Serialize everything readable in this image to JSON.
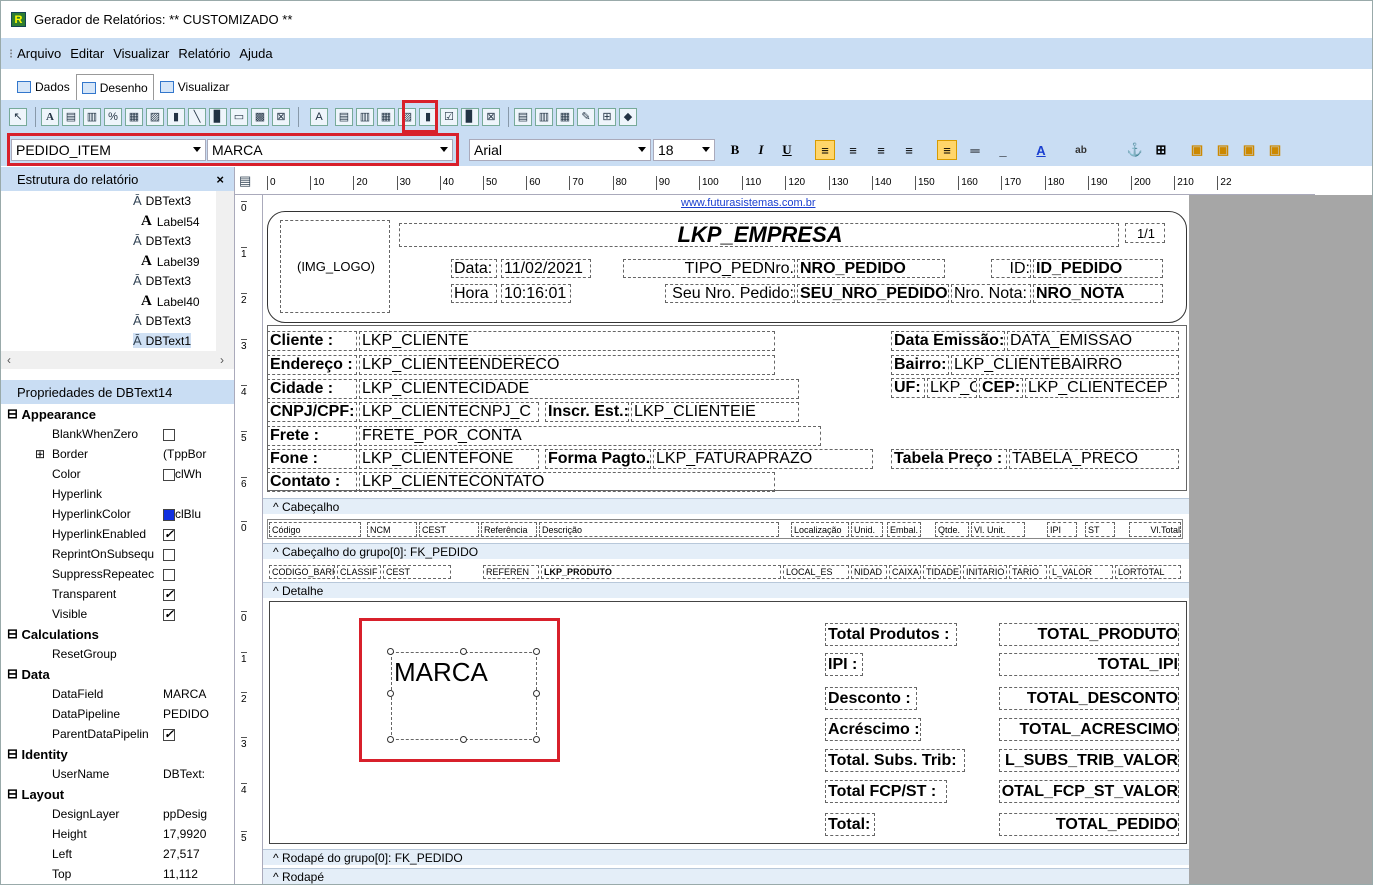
{
  "window": {
    "title": "Gerador de Relatórios: ** CUSTOMIZADO **"
  },
  "menu": [
    "Arquivo",
    "Editar",
    "Visualizar",
    "Relatório",
    "Ajuda"
  ],
  "tabs": [
    "Dados",
    "Desenho",
    "Visualizar"
  ],
  "selectors": {
    "pipeline": "PEDIDO_ITEM",
    "field": "MARCA",
    "font": "Arial",
    "size": "18"
  },
  "tree_panel": {
    "title": "Estrutura do relatório",
    "items": [
      "DBText3",
      "Label54",
      "DBText3",
      "Label39",
      "DBText3",
      "Label40",
      "DBText3",
      "DBText1"
    ]
  },
  "props_panel": {
    "title": "Propriedades de DBText14",
    "categories": [
      {
        "name": "Appearance",
        "rows": [
          {
            "name": "BlankWhenZero",
            "value": ""
          },
          {
            "name": "Border",
            "value": "(TppBor"
          },
          {
            "name": "Color",
            "value": "clWh"
          },
          {
            "name": "Hyperlink",
            "value": ""
          },
          {
            "name": "HyperlinkColor",
            "value": "clBlu"
          },
          {
            "name": "HyperlinkEnabled",
            "value": ""
          },
          {
            "name": "ReprintOnSubsequ",
            "value": ""
          },
          {
            "name": "SuppressRepeatec",
            "value": ""
          },
          {
            "name": "Transparent",
            "value": ""
          },
          {
            "name": "Visible",
            "value": ""
          }
        ]
      },
      {
        "name": "Calculations",
        "rows": [
          {
            "name": "ResetGroup",
            "value": ""
          }
        ]
      },
      {
        "name": "Data",
        "rows": [
          {
            "name": "DataField",
            "value": "MARCA"
          },
          {
            "name": "DataPipeline",
            "value": "PEDIDO"
          },
          {
            "name": "ParentDataPipelin",
            "value": ""
          }
        ]
      },
      {
        "name": "Identity",
        "rows": [
          {
            "name": "UserName",
            "value": "DBText:"
          }
        ]
      },
      {
        "name": "Layout",
        "rows": [
          {
            "name": "DesignLayer",
            "value": "ppDesig"
          },
          {
            "name": "Height",
            "value": "17,9920"
          },
          {
            "name": "Left",
            "value": "27,517"
          },
          {
            "name": "Top",
            "value": "11,112"
          }
        ]
      }
    ]
  },
  "ruler_labels": [
    "0",
    "10",
    "20",
    "30",
    "40",
    "50",
    "60",
    "70",
    "80",
    "90",
    "100",
    "110",
    "120",
    "130",
    "140",
    "150",
    "160",
    "170",
    "180",
    "190",
    "200",
    "210",
    "22"
  ],
  "vruler_labels": [
    "0",
    "1",
    "2",
    "3",
    "4",
    "5",
    "6",
    "0",
    "0",
    "1",
    "2",
    "3",
    "4",
    "5"
  ],
  "report": {
    "website": "www.futurasistemas.com.br",
    "company": "LKP_EMPRESA",
    "pages": "1/1",
    "logo": "(IMG_LOGO)",
    "data_label": "Data:",
    "data_value": "11/02/2021",
    "hora_label": "Hora",
    "hora_value": "10:16:01",
    "tipo": "TIPO_PEDNro.",
    "nro_pedido": "NRO_PEDIDO",
    "id_label": "ID:",
    "id_pedido": "ID_PEDIDO",
    "seu_label": "Seu Nro. Pedido:",
    "seu_nro": "SEU_NRO_PEDIDO",
    "nota_label": "Nro. Nota:",
    "nro_nota": "NRO_NOTA",
    "cliente_label": "Cliente :",
    "cliente": "LKP_CLIENTE",
    "endereco_label": "Endereço :",
    "endereco": "LKP_CLIENTEENDERECO",
    "cidade_label": "Cidade :",
    "cidade": "LKP_CLIENTECIDADE",
    "cnpj_label": "CNPJ/CPF:",
    "cnpj": "LKP_CLIENTECNPJ_C",
    "inscr_label": "Inscr. Est.:",
    "inscr": "LKP_CLIENTEIE",
    "frete_label": "Frete :",
    "frete": "FRETE_POR_CONTA",
    "fone_label": "Fone :",
    "fone": "LKP_CLIENTEFONE",
    "forma_label": "Forma Pagto.",
    "forma": "LKP_FATURAPRAZO",
    "tabela_label": "Tabela Preço :",
    "tabela": "TABELA_PRECO",
    "contato_label": "Contato :",
    "contato": "LKP_CLIENTECONTATO",
    "emissao_label": "Data Emissão:",
    "emissao": "DATA_EMISSAO",
    "bairro_label": "Bairro:",
    "bairro": "LKP_CLIENTEBAIRRO",
    "uf_label": "UF:",
    "uf": "LKP_C",
    "cep_label": "CEP:",
    "cep": "LKP_CLIENTECEP",
    "bands": {
      "cabecalho": "^ Cabeçalho",
      "grupo": "^ Cabeçalho do grupo[0]: FK_PEDIDO",
      "detalhe": "^ Detalhe",
      "rodape_grupo": "^ Rodapé do grupo[0]: FK_PEDIDO",
      "rodape": "^ Rodapé"
    },
    "columns": [
      "Código",
      "NCM",
      "CEST",
      "Referência",
      "Descrição",
      "Localização",
      "Unid.",
      "Embal.",
      "Qtde.",
      "Vl. Unit.",
      "IPI",
      "ST",
      "Vl.Total"
    ],
    "detail_fields": [
      "CODIGO_BARRA",
      "CLASSIF",
      "CEST",
      "REFEREN",
      "LKP_PRODUTO",
      "LOCAL_ES",
      "NIDAD",
      "CAIXA",
      "TIDADE",
      "INITARIO",
      "TARIO",
      "L_VALOR",
      "LORTOTAL"
    ],
    "marca": "MARCA",
    "totals": [
      {
        "label": "Total Produtos :",
        "value": "TOTAL_PRODUTO"
      },
      {
        "label": "IPI :",
        "value": "TOTAL_IPI"
      },
      {
        "label": "Desconto :",
        "value": "TOTAL_DESCONTO"
      },
      {
        "label": "Acréscimo :",
        "value": "TOTAL_ACRESCIMO"
      },
      {
        "label": "Total. Subs. Trib:",
        "value": "L_SUBS_TRIB_VALOR"
      },
      {
        "label": "Total FCP/ST :",
        "value": "OTAL_FCP_ST_VALOR"
      },
      {
        "label": "Total:",
        "value": "TOTAL_PEDIDO"
      }
    ]
  },
  "colors": {
    "accent": "#d8202b",
    "toolbar": "#c9ddf3",
    "highlight": "#ffd56a"
  }
}
